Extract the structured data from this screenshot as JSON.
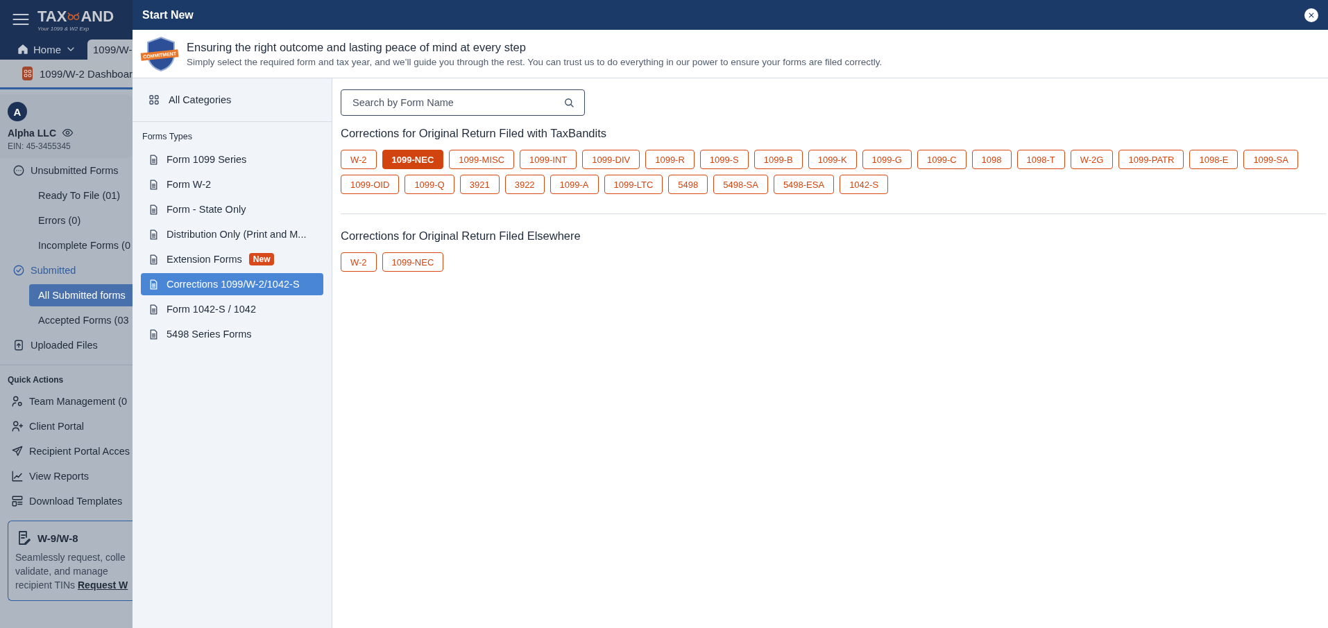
{
  "app": {
    "logo": {
      "left": "TAX",
      "right": "AND",
      "tagline": "Your 1099 & W2 Exp"
    },
    "nav_tabs": [
      {
        "label": "Home",
        "selected": false
      },
      {
        "label": "1099/W-",
        "selected": true
      }
    ],
    "breadcrumb": "1099/W-2 Dashboar",
    "company": {
      "avatar": "A",
      "name": "Alpha LLC",
      "ein": "EIN: 45-3455345"
    },
    "nav": [
      {
        "label": "Unsubmitted Forms",
        "active": false,
        "children": [
          {
            "label": "Ready To File (01)",
            "selected": false
          },
          {
            "label": "Errors (0)",
            "selected": false
          },
          {
            "label": "Incomplete Forms (0",
            "selected": false
          }
        ]
      },
      {
        "label": "Submitted",
        "active": true,
        "children": [
          {
            "label": "All Submitted forms",
            "selected": true
          },
          {
            "label": "Accepted Forms (03",
            "selected": false
          }
        ]
      },
      {
        "label": "Uploaded Files",
        "active": false
      }
    ],
    "quick_actions": {
      "title": "Quick Actions",
      "items": [
        "Team Management (0",
        "Client Portal",
        "Recipient Portal Acces",
        "View Reports",
        "Download Templates"
      ]
    },
    "promo": {
      "title": "W-9/W-8",
      "text": "Seamlessly request, colle validate, and manage recipient TINs",
      "link": "Request W"
    }
  },
  "modal": {
    "title": "Start New",
    "banner": {
      "badge": "COMMITMENT",
      "heading": "Ensuring the right outcome and lasting peace of mind at every step",
      "text": "Simply select the required form and tax year, and we’ll guide you through the rest. You can trust us to do everything in our power to ensure your forms are filed correctly."
    },
    "all_categories": "All Categories",
    "types_title": "Forms Types",
    "types": [
      {
        "label": "Form 1099 Series",
        "selected": false
      },
      {
        "label": "Form W-2",
        "selected": false
      },
      {
        "label": "Form - State Only",
        "selected": false
      },
      {
        "label": "Distribution Only (Print and M...",
        "selected": false
      },
      {
        "label": "Extension Forms",
        "badge": "New",
        "selected": false
      },
      {
        "label": "Corrections 1099/W-2/1042-S",
        "selected": true
      },
      {
        "label": "Form 1042-S / 1042",
        "selected": false
      },
      {
        "label": "5498 Series Forms",
        "selected": false
      }
    ],
    "search": {
      "placeholder": "Search by Form Name"
    },
    "sections": [
      {
        "title": "Corrections for Original Return Filed with TaxBandits",
        "forms": [
          {
            "label": "W-2",
            "selected": false
          },
          {
            "label": "1099-NEC",
            "selected": true
          },
          {
            "label": "1099-MISC",
            "selected": false
          },
          {
            "label": "1099-INT",
            "selected": false
          },
          {
            "label": "1099-DIV",
            "selected": false
          },
          {
            "label": "1099-R",
            "selected": false
          },
          {
            "label": "1099-S",
            "selected": false
          },
          {
            "label": "1099-B",
            "selected": false
          },
          {
            "label": "1099-K",
            "selected": false
          },
          {
            "label": "1099-G",
            "selected": false
          },
          {
            "label": "1099-C",
            "selected": false
          },
          {
            "label": "1098",
            "selected": false
          },
          {
            "label": "1098-T",
            "selected": false
          },
          {
            "label": "W-2G",
            "selected": false
          },
          {
            "label": "1099-PATR",
            "selected": false
          },
          {
            "label": "1098-E",
            "selected": false
          },
          {
            "label": "1099-SA",
            "selected": false
          },
          {
            "label": "1099-OID",
            "selected": false
          },
          {
            "label": "1099-Q",
            "selected": false
          },
          {
            "label": "3921",
            "selected": false
          },
          {
            "label": "3922",
            "selected": false
          },
          {
            "label": "1099-A",
            "selected": false
          },
          {
            "label": "1099-LTC",
            "selected": false
          },
          {
            "label": "5498",
            "selected": false
          },
          {
            "label": "5498-SA",
            "selected": false
          },
          {
            "label": "5498-ESA",
            "selected": false
          },
          {
            "label": "1042-S",
            "selected": false
          }
        ]
      },
      {
        "title": "Corrections for Original Return Filed Elsewhere",
        "forms": [
          {
            "label": "W-2",
            "selected": false
          },
          {
            "label": "1099-NEC",
            "selected": false
          }
        ]
      }
    ]
  }
}
